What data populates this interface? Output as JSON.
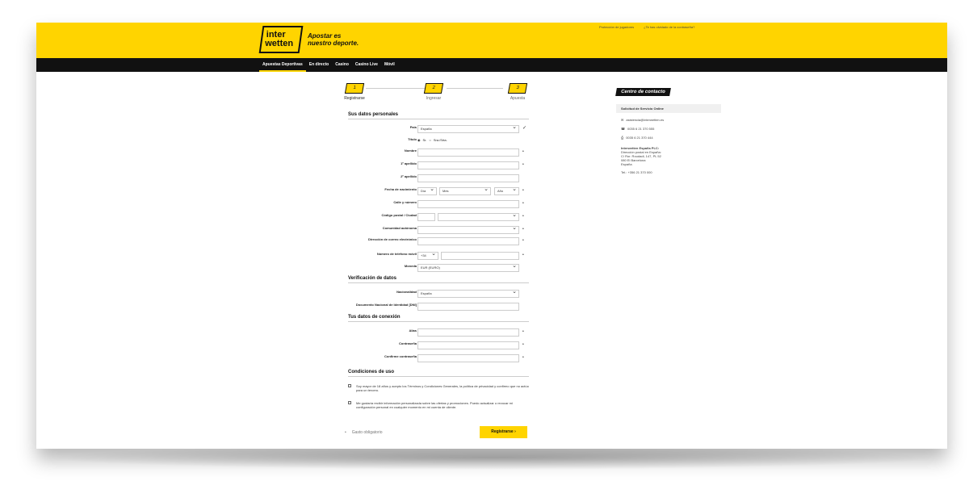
{
  "header": {
    "logo_top": "inter",
    "logo_bottom": "wetten",
    "tagline_1": "Apostar es",
    "tagline_2": "nuestro deporte.",
    "top_link_1": "Protección de jugadores",
    "top_link_2": "¿Te has olvidado de la contraseña?"
  },
  "nav": {
    "items": [
      "Apuestas Deportivas",
      "En directo",
      "Casino",
      "Casino Live",
      "Móvil"
    ]
  },
  "steps": {
    "items": [
      {
        "num": "1",
        "label": "Registrarse"
      },
      {
        "num": "2",
        "label": "Ingresar"
      },
      {
        "num": "3",
        "label": "Apuesta"
      }
    ]
  },
  "sections": {
    "personal": "Sus datos personales",
    "verification": "Verificación de datos",
    "connection": "Tus datos de conexión",
    "conditions": "Condiciones de uso"
  },
  "fields": {
    "pais_label": "País",
    "pais_value": "España",
    "titulo_label": "Título",
    "titulo_opt1": "Sr.",
    "titulo_opt2": "Sra./Srta.",
    "nombre_label": "Nombre",
    "apellido1_label": "1º apellido",
    "apellido2_label": "2º apellido",
    "fecha_label": "Fecha de nacimiento",
    "fecha_dia": "Día",
    "fecha_mes": "Mes",
    "fecha_anio": "Año",
    "calle_label": "Calle y número",
    "cp_label": "Código postal / Ciudad",
    "comunidad_label": "Comunidad autónoma",
    "email_label": "Dirección de correo electrónico",
    "movil_label": "Número de teléfono móvil",
    "movil_prefix": "+34",
    "moneda_label": "Moneda",
    "moneda_value": "EUR (EURO)",
    "nacionalidad_label": "Nacionalidad",
    "nacionalidad_value": "España",
    "dni_label": "Documento Nacional de Identidad [DNI]",
    "alias_label": "Alias",
    "contrasena_label": "Contraseña",
    "confirme_label": "Confirme contraseña"
  },
  "terms": {
    "text_1": "Soy mayor de 18 años y acepto los Términos y Condiciones Generales, la política de privacidad y confirmo que no actúo para un tercero.",
    "text_2": "Me gustaría recibir información personalizada sobre las ofertas y promociones. Puedo actualizar o revocar mi configuración personal en cualquier momento en mi cuenta de cliente."
  },
  "footer": {
    "help": "Gasto obligatorio",
    "register_button": "Registrarse"
  },
  "contact": {
    "title": "Centro de contacto",
    "box": "Solicitud de Servicio Online",
    "email": "asistencia@interwetten.es",
    "phone": "0035 6 21 370 555",
    "fax": "0035 6 21 370 444",
    "company": "Interwetten España PLC:",
    "addr_1": "Dirección postal en España:",
    "addr_2": "C/ Ror. Roudadi, 147, PL 52",
    "addr_3": "080 El Barcelona",
    "addr_4": "España",
    "tel": "Tel.: +356 21 370 000"
  },
  "colors": {
    "brand": "#ffd400",
    "nav_bg": "#111111"
  }
}
